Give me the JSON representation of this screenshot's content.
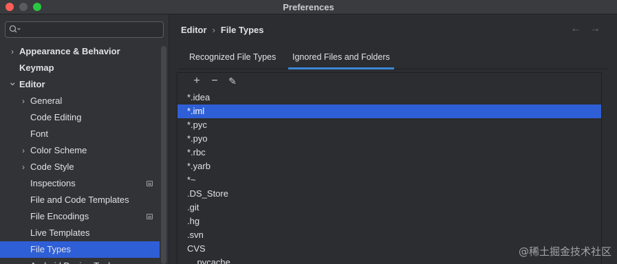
{
  "window": {
    "title": "Preferences"
  },
  "search": {
    "placeholder": ""
  },
  "sidebar": {
    "items": [
      {
        "label": "Appearance & Behavior",
        "level": 0,
        "bold": true,
        "chevron": "right"
      },
      {
        "label": "Keymap",
        "level": 0,
        "bold": true,
        "chevron": ""
      },
      {
        "label": "Editor",
        "level": 0,
        "bold": true,
        "chevron": "down"
      },
      {
        "label": "General",
        "level": 1,
        "bold": false,
        "chevron": "right"
      },
      {
        "label": "Code Editing",
        "level": 1,
        "bold": false,
        "chevron": ""
      },
      {
        "label": "Font",
        "level": 1,
        "bold": false,
        "chevron": ""
      },
      {
        "label": "Color Scheme",
        "level": 1,
        "bold": false,
        "chevron": "right"
      },
      {
        "label": "Code Style",
        "level": 1,
        "bold": false,
        "chevron": "right"
      },
      {
        "label": "Inspections",
        "level": 1,
        "bold": false,
        "chevron": "",
        "badge": true
      },
      {
        "label": "File and Code Templates",
        "level": 1,
        "bold": false,
        "chevron": ""
      },
      {
        "label": "File Encodings",
        "level": 1,
        "bold": false,
        "chevron": "",
        "badge": true
      },
      {
        "label": "Live Templates",
        "level": 1,
        "bold": false,
        "chevron": ""
      },
      {
        "label": "File Types",
        "level": 1,
        "bold": false,
        "chevron": "",
        "selected": true
      },
      {
        "label": "Android Design Tools",
        "level": 1,
        "bold": false,
        "chevron": ""
      }
    ]
  },
  "breadcrumb": {
    "parent": "Editor",
    "separator": "›",
    "current": "File Types"
  },
  "nav": {
    "back": "←",
    "forward": "→"
  },
  "tabs": [
    {
      "label": "Recognized File Types",
      "active": false
    },
    {
      "label": "Ignored Files and Folders",
      "active": true
    }
  ],
  "toolbar": {
    "add": "+",
    "remove": "−",
    "edit": "✎"
  },
  "ignored_list": [
    "*.idea",
    "*.iml",
    "*.pyc",
    "*.pyo",
    "*.rbc",
    "*.yarb",
    "*~",
    ".DS_Store",
    ".git",
    ".hg",
    ".svn",
    "CVS",
    "__pycache__"
  ],
  "selected_index": 1,
  "watermark": "@稀土掘金技术社区",
  "colors": {
    "accent": "#2f5fd6",
    "tab_underline": "#3d86d9",
    "background": "#2b2d30",
    "sidebar": "#313337"
  }
}
